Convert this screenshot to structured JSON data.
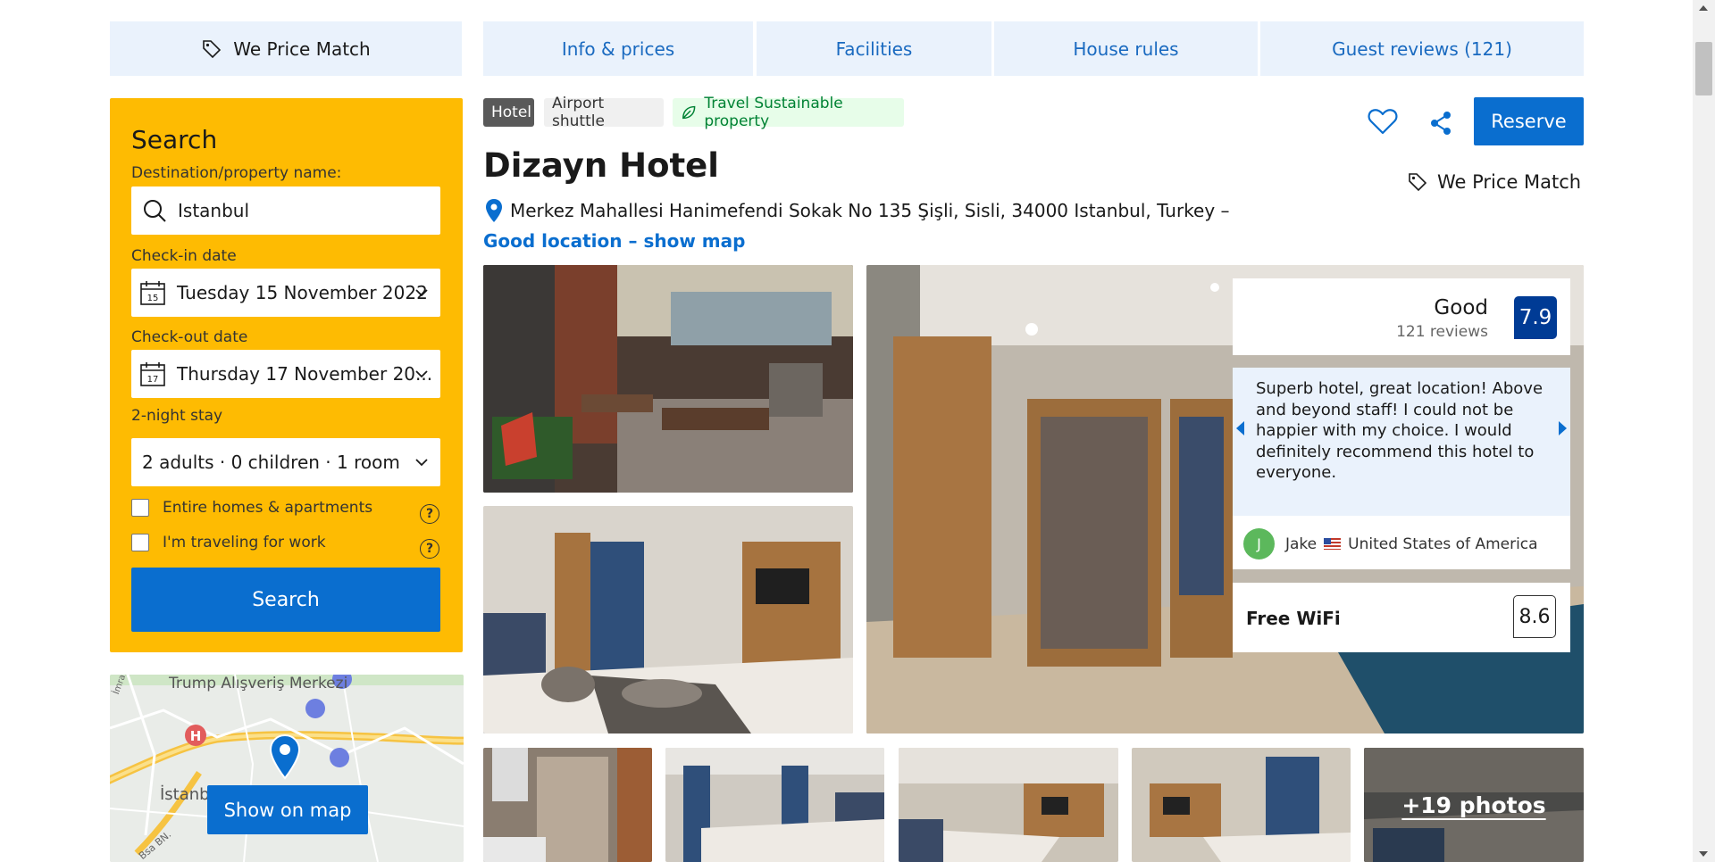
{
  "nav": {
    "price_match": "We Price Match",
    "tabs": [
      {
        "label": "Info & prices"
      },
      {
        "label": "Facilities"
      },
      {
        "label": "House rules"
      },
      {
        "label": "Guest reviews (121)"
      }
    ]
  },
  "search": {
    "title": "Search",
    "destination_label": "Destination/property name:",
    "destination_value": "Istanbul",
    "checkin_label": "Check-in date",
    "checkin_value": "Tuesday 15 November 2022",
    "checkin_day": "15",
    "checkout_label": "Check-out date",
    "checkout_value": "Thursday 17 November 20...",
    "checkout_day": "17",
    "stay_label": "2-night stay",
    "guests_value": "2 adults · 0 children · 1 room",
    "check_entire_homes": "Entire homes & apartments",
    "check_work": "I'm traveling for work",
    "button": "Search"
  },
  "map": {
    "label_mall": "Trump Alışveriş Merkezi",
    "label_city": "İstanbul",
    "label_street": "İmrahor C.",
    "label_road": "Bsa BN.",
    "button": "Show on map"
  },
  "badges": {
    "hotel": "Hotel",
    "shuttle": "Airport shuttle",
    "sustainable": "Travel Sustainable property"
  },
  "hotel": {
    "name": "Dizayn Hotel",
    "address": "Merkez Mahallesi Hanimefendi Sokak No 135 Şişli, Sisli, 34000 Istanbul, Turkey –",
    "location_link": "Good location – show map"
  },
  "actions": {
    "reserve": "Reserve",
    "price_match": "We Price Match"
  },
  "rating": {
    "word": "Good",
    "count": "121 reviews",
    "score": "7.9"
  },
  "review": {
    "text": "Superb hotel, great location! Above and beyond staff! I could not be happier with my choice. I would definitely recommend this hotel to everyone.",
    "avatar_letter": "J",
    "reviewer_name": "Jake",
    "reviewer_country": "United States of America"
  },
  "wifi": {
    "label": "Free WiFi",
    "score": "8.6"
  },
  "photos": {
    "more_label": "+19 photos"
  },
  "colors": {
    "brand_blue": "#0a6ecf",
    "search_yellow": "#febb02",
    "score_navy": "#003b95",
    "nav_bg": "#eaf2fc",
    "sustainable_green": "#008234"
  }
}
